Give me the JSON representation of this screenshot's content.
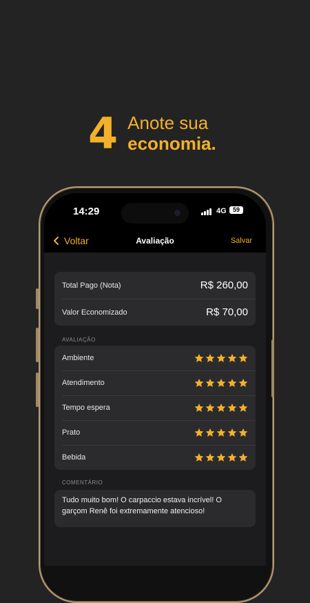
{
  "promo": {
    "number": "4",
    "line1": "Anote sua",
    "line2": "economia."
  },
  "status": {
    "time": "14:29",
    "network": "4G",
    "battery": "59"
  },
  "nav": {
    "back_label": "Voltar",
    "title": "Avaliação",
    "save_label": "Salvar"
  },
  "summary": [
    {
      "label": "Total Pago (Nota)",
      "value": "R$ 260,00"
    },
    {
      "label": "Valor Economizado",
      "value": "R$ 70,00"
    }
  ],
  "rating": {
    "section_label": "AVALIAÇÃO",
    "items": [
      {
        "label": "Ambiente",
        "stars": 5
      },
      {
        "label": "Atendimento",
        "stars": 5
      },
      {
        "label": "Tempo espera",
        "stars": 5
      },
      {
        "label": "Prato",
        "stars": 5
      },
      {
        "label": "Bebida",
        "stars": 5
      }
    ]
  },
  "comment": {
    "section_label": "COMENTÁRIO",
    "text": "Tudo muito bom! O carpaccio estava incrível! O garçom Renê foi extremamente atencioso!"
  },
  "colors": {
    "accent": "#f3b02b",
    "background": "#232323",
    "card": "#2b2b2d"
  }
}
